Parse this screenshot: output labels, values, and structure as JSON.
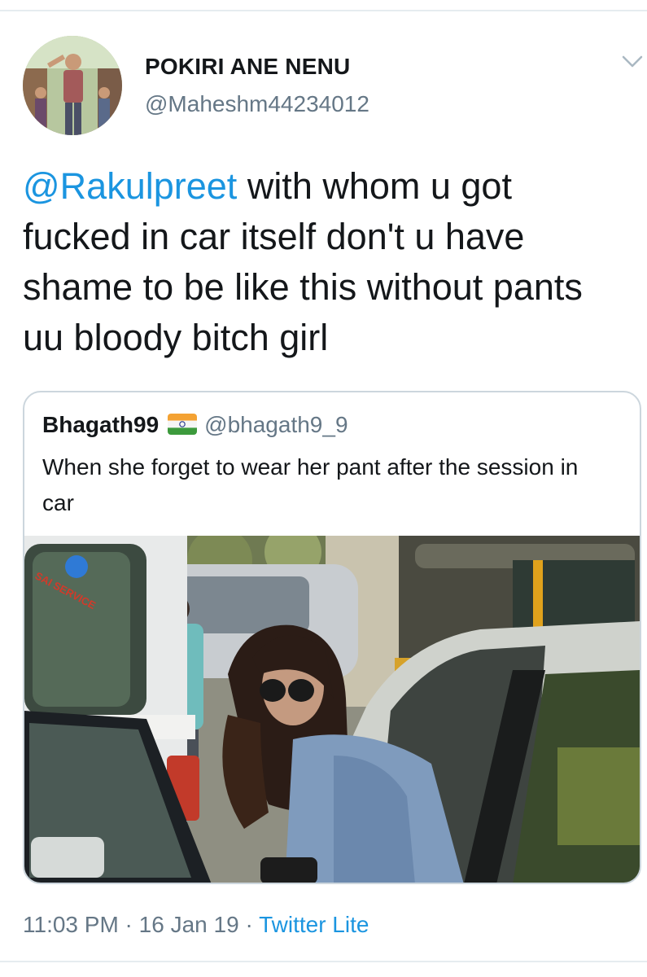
{
  "tweet": {
    "display_name": "POKIRI ANE NENU",
    "handle": "@Maheshm44234012",
    "mention": "@Rakulpreet",
    "text": " with whom u got fucked in car itself don't u have shame to be like this without pants uu bloody bitch girl",
    "time": "11:03 PM",
    "separator": " · ",
    "date": "16 Jan 19",
    "source": "Twitter Lite"
  },
  "quoted": {
    "display_name": "Bhagath99",
    "flag": "india-flag-emoji",
    "handle": "@bhagath9_9",
    "text": "When she forget to wear her pant after the session in car",
    "photo": {
      "sticker_text": "SAI SERVICE"
    }
  },
  "colors": {
    "link": "#1b95e0",
    "secondary_text": "#657786",
    "primary_text": "#14171a",
    "border": "#ccd6dd"
  },
  "icons": {
    "menu": "chevron-down-icon"
  }
}
